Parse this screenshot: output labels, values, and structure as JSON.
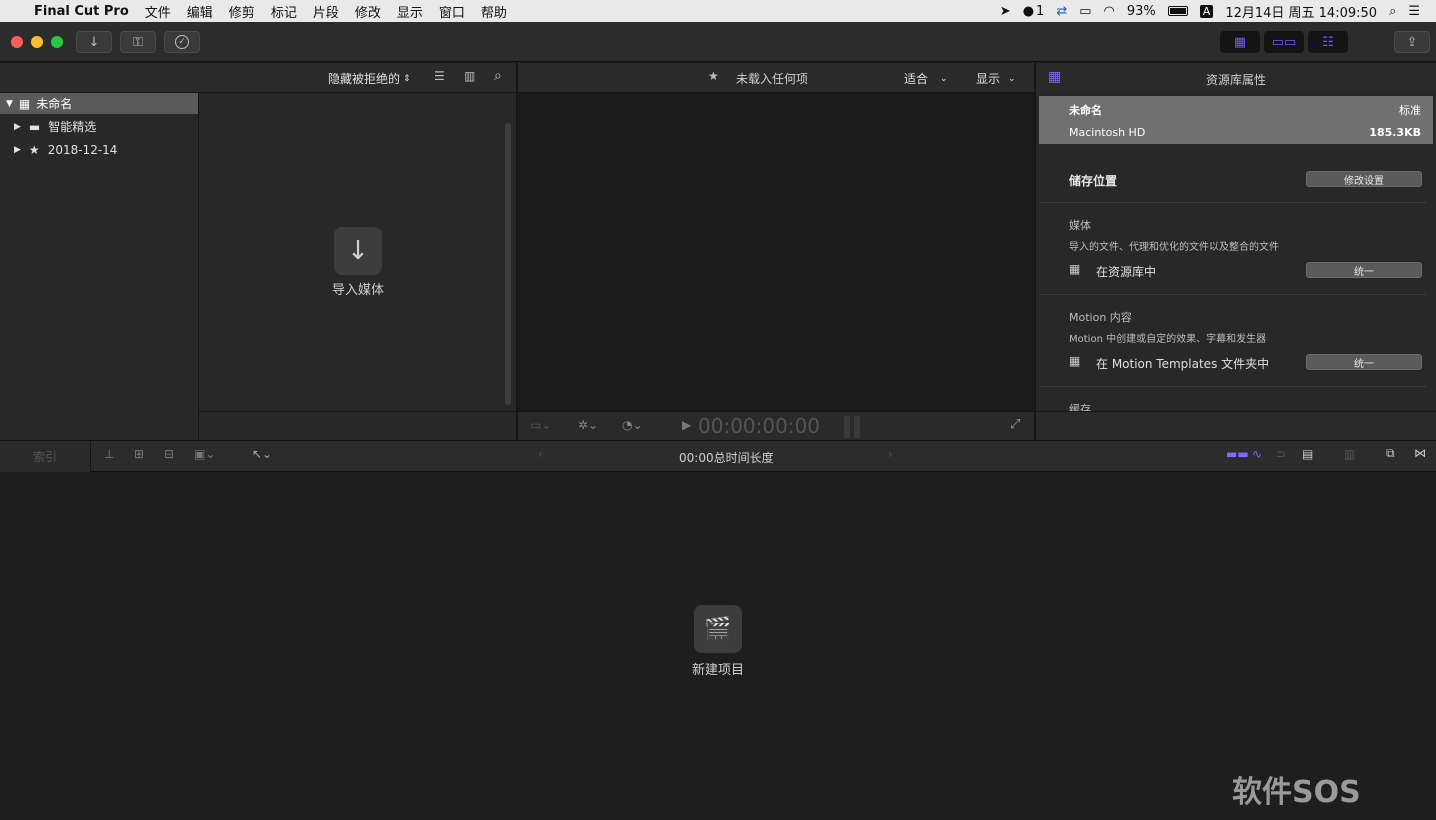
{
  "menubar": {
    "apple": "",
    "app": "Final Cut Pro",
    "items": [
      "文件",
      "编辑",
      "修剪",
      "标记",
      "片段",
      "修改",
      "显示",
      "窗口",
      "帮助"
    ],
    "status": {
      "notifications": "1",
      "battery": "93%",
      "input": "A",
      "datetime": "12月14日 周五  14:09:50"
    }
  },
  "toolbar": {
    "import_icon": "↓",
    "keyword_icon": "⚿",
    "analyze_icon": "✓"
  },
  "browser": {
    "filter": "隐藏被拒绝的",
    "library": "未命名",
    "items": [
      "智能精选",
      "2018-12-14"
    ],
    "import_label": "导入媒体"
  },
  "viewer": {
    "title": "未载入任何项",
    "fit": "适合",
    "view": "显示",
    "timecode": "00:00:00:00"
  },
  "inspector": {
    "title": "资源库属性",
    "library_name": "未命名",
    "library_status": "标准",
    "disk": "Macintosh HD",
    "size": "185.3KB",
    "storage_label": "储存位置",
    "modify_button": "修改设置",
    "media": {
      "heading": "媒体",
      "desc": "导入的文件、代理和优化的文件以及整合的文件",
      "location": "在资源库中",
      "button": "统一"
    },
    "motion": {
      "heading": "Motion 内容",
      "desc": "Motion 中创建或自定的效果、字幕和发生器",
      "location": "在 Motion Templates 文件夹中",
      "button": "统一"
    },
    "cache_heading": "缓存"
  },
  "timeline": {
    "index": "索引",
    "duration": "00:00总时间长度",
    "new_project": "新建项目"
  },
  "watermark": "软件SOS",
  "colors": {
    "accent": "#7b6bff",
    "panel": "#282828",
    "dark": "#1e1e1e"
  }
}
